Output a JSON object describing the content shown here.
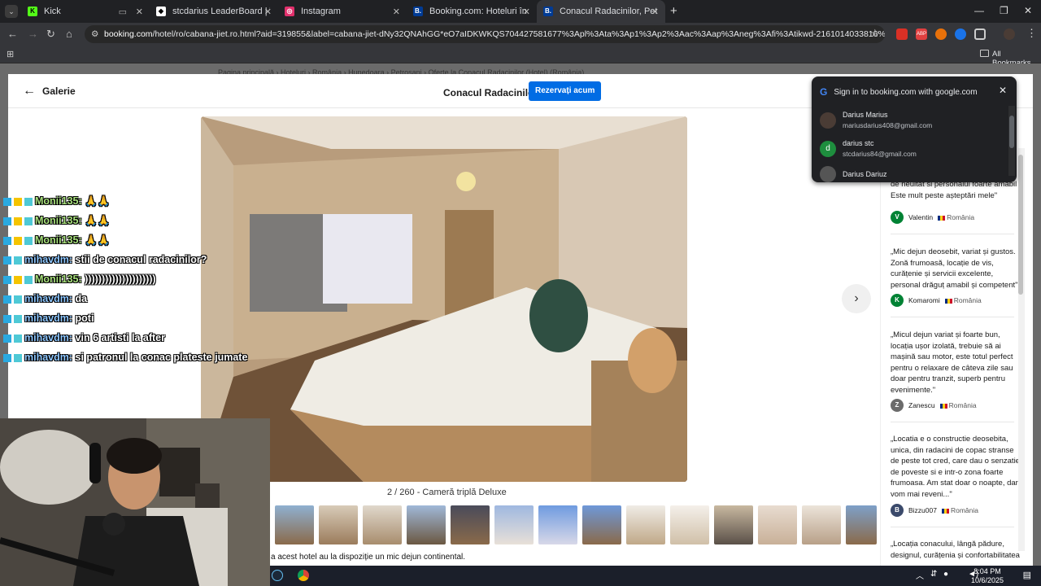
{
  "browser": {
    "tabs": [
      {
        "title": "Kick",
        "favicon_color": "#53fc18"
      },
      {
        "title": "stcdarius LeaderBoard | The be",
        "favicon_color": "#ffffff"
      },
      {
        "title": "Instagram",
        "favicon_color": "#e1306c"
      },
      {
        "title": "Booking.com: Hoteluri în Petroș",
        "favicon_color": "#003b95"
      },
      {
        "title": "Conacul Radacinilor, Petroșani",
        "favicon_color": "#003b95"
      }
    ],
    "url_host": "booking.com",
    "url_path": "/hotel/ro/cabana-jiet.ro.html?aid=319855&label=cabana-jiet-dNy32QNAhGG*eO7aIDKWKQS704427581677%3Apl%3Ata%3Ap1%3Ap2%3Aac%3Aap%3Aneg%3Afi%3Atikwd-2161014033816%3Alp1011818%3Ali...",
    "all_bookmarks": "All Bookmarks"
  },
  "page": {
    "breadcrumbs": "Pagina principală  ›  Hoteluri  ›  România  ›  Hunedoara  ›  Petroșani  ›  Oferte la Conacul Radacinilor (Hotel) (România)"
  },
  "gallery": {
    "back_label": "Galerie",
    "hotel_name": "Conacul Radacinilor",
    "reserve_label": "Rezervați acum",
    "caption": "2 / 260 - Cameră triplă Deluxe",
    "thumb_count": 14,
    "footer": "a acest hotel au la dispoziție un mic dejun continental."
  },
  "reviews": [
    {
      "text": "de neuitat si personalul foarte amabil Este mult peste așteptări mele\"",
      "author": "Valentin",
      "initial": "V",
      "country": "România",
      "color": "#008234"
    },
    {
      "text": "„Mic dejun deosebit, variat și gustos. Zonă frumoasă, locație de vis, curățenie și servicii excelente, personal drăguț amabil și competent\"",
      "author": "Komaromi",
      "initial": "K",
      "country": "România",
      "color": "#008234"
    },
    {
      "text": "„Micul dejun variat și foarte bun, locația ușor izolată, trebuie să ai mașină sau motor, este totul perfect pentru o relaxare de câteva zile sau doar pentru tranzit, superb pentru evenimente.\"",
      "author": "Zanescu",
      "initial": "Z",
      "country": "România",
      "color": "#6b6b6b"
    },
    {
      "text": "„Locatia e o constructie deosebita, unica, din radacini de copac stranse de peste tot cred, care dau o senzatie de poveste si e intr-o zona foarte frumoasa. Am stat doar o noapte, dar vom mai reveni...\"",
      "author": "Bizzu007",
      "initial": "B",
      "country": "România",
      "color": "#3b4a6b"
    },
    {
      "text": "„Locația conacului, lângă pădure, designul, curățenia și confortabilitatea",
      "author": "",
      "initial": "",
      "country": "",
      "color": "#ffffff"
    }
  ],
  "google_popup": {
    "title": "Sign in to booking.com with google.com",
    "accounts": [
      {
        "name": "Darius Marius",
        "email": "mariusdarius408@gmail.com",
        "initial": "",
        "color": "#4a3c35"
      },
      {
        "name": "darius stc",
        "email": "stcdarius84@gmail.com",
        "initial": "d",
        "color": "#1e8e3e"
      },
      {
        "name": "Darius Dariuz",
        "email": "",
        "initial": "",
        "color": "#555555"
      }
    ]
  },
  "chat": [
    {
      "user": "Monii135:",
      "msg": "🙏🙏"
    },
    {
      "user": "Monii135:",
      "msg": "🙏🙏"
    },
    {
      "user": "Monii135:",
      "msg": "🙏🙏"
    },
    {
      "user": "mihavdm:",
      "msg": "stii de conacul radacinilor?"
    },
    {
      "user": "Monii135:",
      "msg": ")))))))))))))))))))))"
    },
    {
      "user": "mihavdm:",
      "msg": "da"
    },
    {
      "user": "mihavdm:",
      "msg": "poti"
    },
    {
      "user": "mihavdm:",
      "msg": "vin 6 artisti la after"
    },
    {
      "user": "mihavdm:",
      "msg": "si patronul la conac plateste jumate"
    }
  ],
  "taskbar": {
    "time": "8:04 PM",
    "date": "10/6/2025"
  }
}
